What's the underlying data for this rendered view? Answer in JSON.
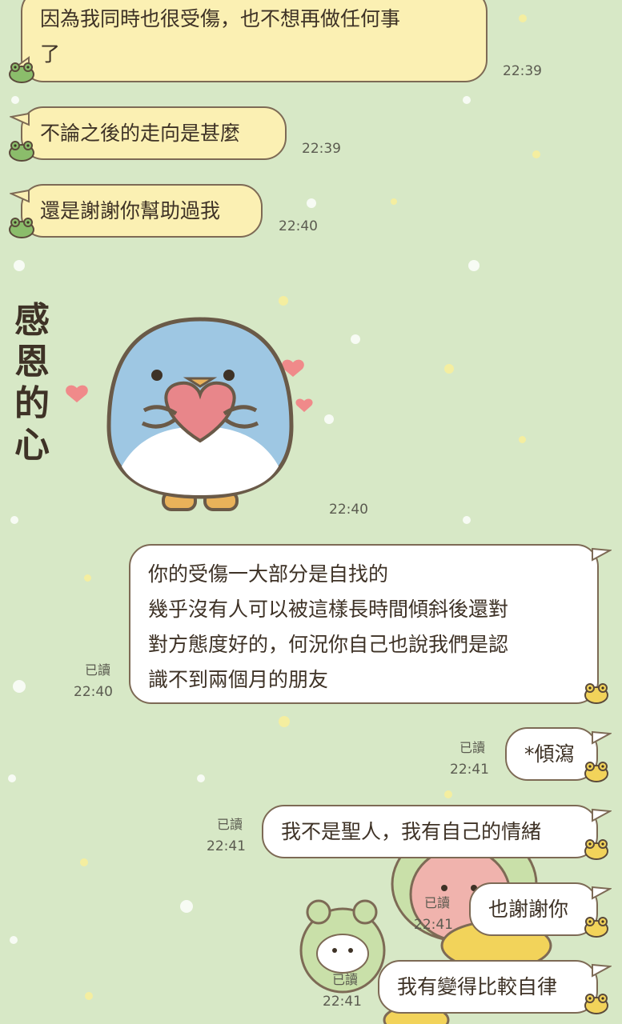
{
  "colors": {
    "background": "#d7e8c6",
    "incoming_bubble": "#fbf0b3",
    "outgoing_bubble": "#ffffff",
    "bubble_border": "#7d6a55",
    "frog_green": "#8bbd6b",
    "chick_yellow": "#f2d35a"
  },
  "messages": [
    {
      "side": "incoming",
      "text": "因為我同時也很受傷，也不想再做任何事了",
      "lines": [
        "因為我同時也很受傷，也不想再做任何事",
        "了"
      ],
      "time": "22:39",
      "avatar_icon": "frog-avatar-icon"
    },
    {
      "side": "incoming",
      "text": "不論之後的走向是甚麼",
      "time": "22:39",
      "avatar_icon": "frog-avatar-icon"
    },
    {
      "side": "incoming",
      "text": "還是謝謝你幫助過我",
      "time": "22:40",
      "avatar_icon": "frog-avatar-icon"
    },
    {
      "side": "incoming",
      "type": "sticker",
      "sticker_text": [
        "感",
        "恩",
        "的",
        "心"
      ],
      "sticker_icon": "penguin-heart-sticker-icon",
      "time": "22:40"
    },
    {
      "side": "outgoing",
      "lines": [
        "你的受傷一大部分是自找的",
        "幾乎沒有人可以被這樣長時間傾斜後還對",
        "對方態度好的，何況你自己也說我們是認",
        "識不到兩個月的朋友"
      ],
      "read": "已讀",
      "time": "22:40",
      "avatar_icon": "chick-avatar-icon"
    },
    {
      "side": "outgoing",
      "text": "*傾瀉",
      "read": "已讀",
      "time": "22:41",
      "avatar_icon": "chick-avatar-icon"
    },
    {
      "side": "outgoing",
      "text": "我不是聖人，我有自己的情緒",
      "read": "已讀",
      "time": "22:41",
      "avatar_icon": "chick-avatar-icon"
    },
    {
      "side": "outgoing",
      "text": "也謝謝你",
      "read": "已讀",
      "time": "22:41",
      "avatar_icon": "chick-avatar-icon"
    },
    {
      "side": "outgoing",
      "text": "我有變得比較自律",
      "read": "已讀",
      "time": "22:41",
      "avatar_icon": "chick-avatar-icon"
    }
  ]
}
